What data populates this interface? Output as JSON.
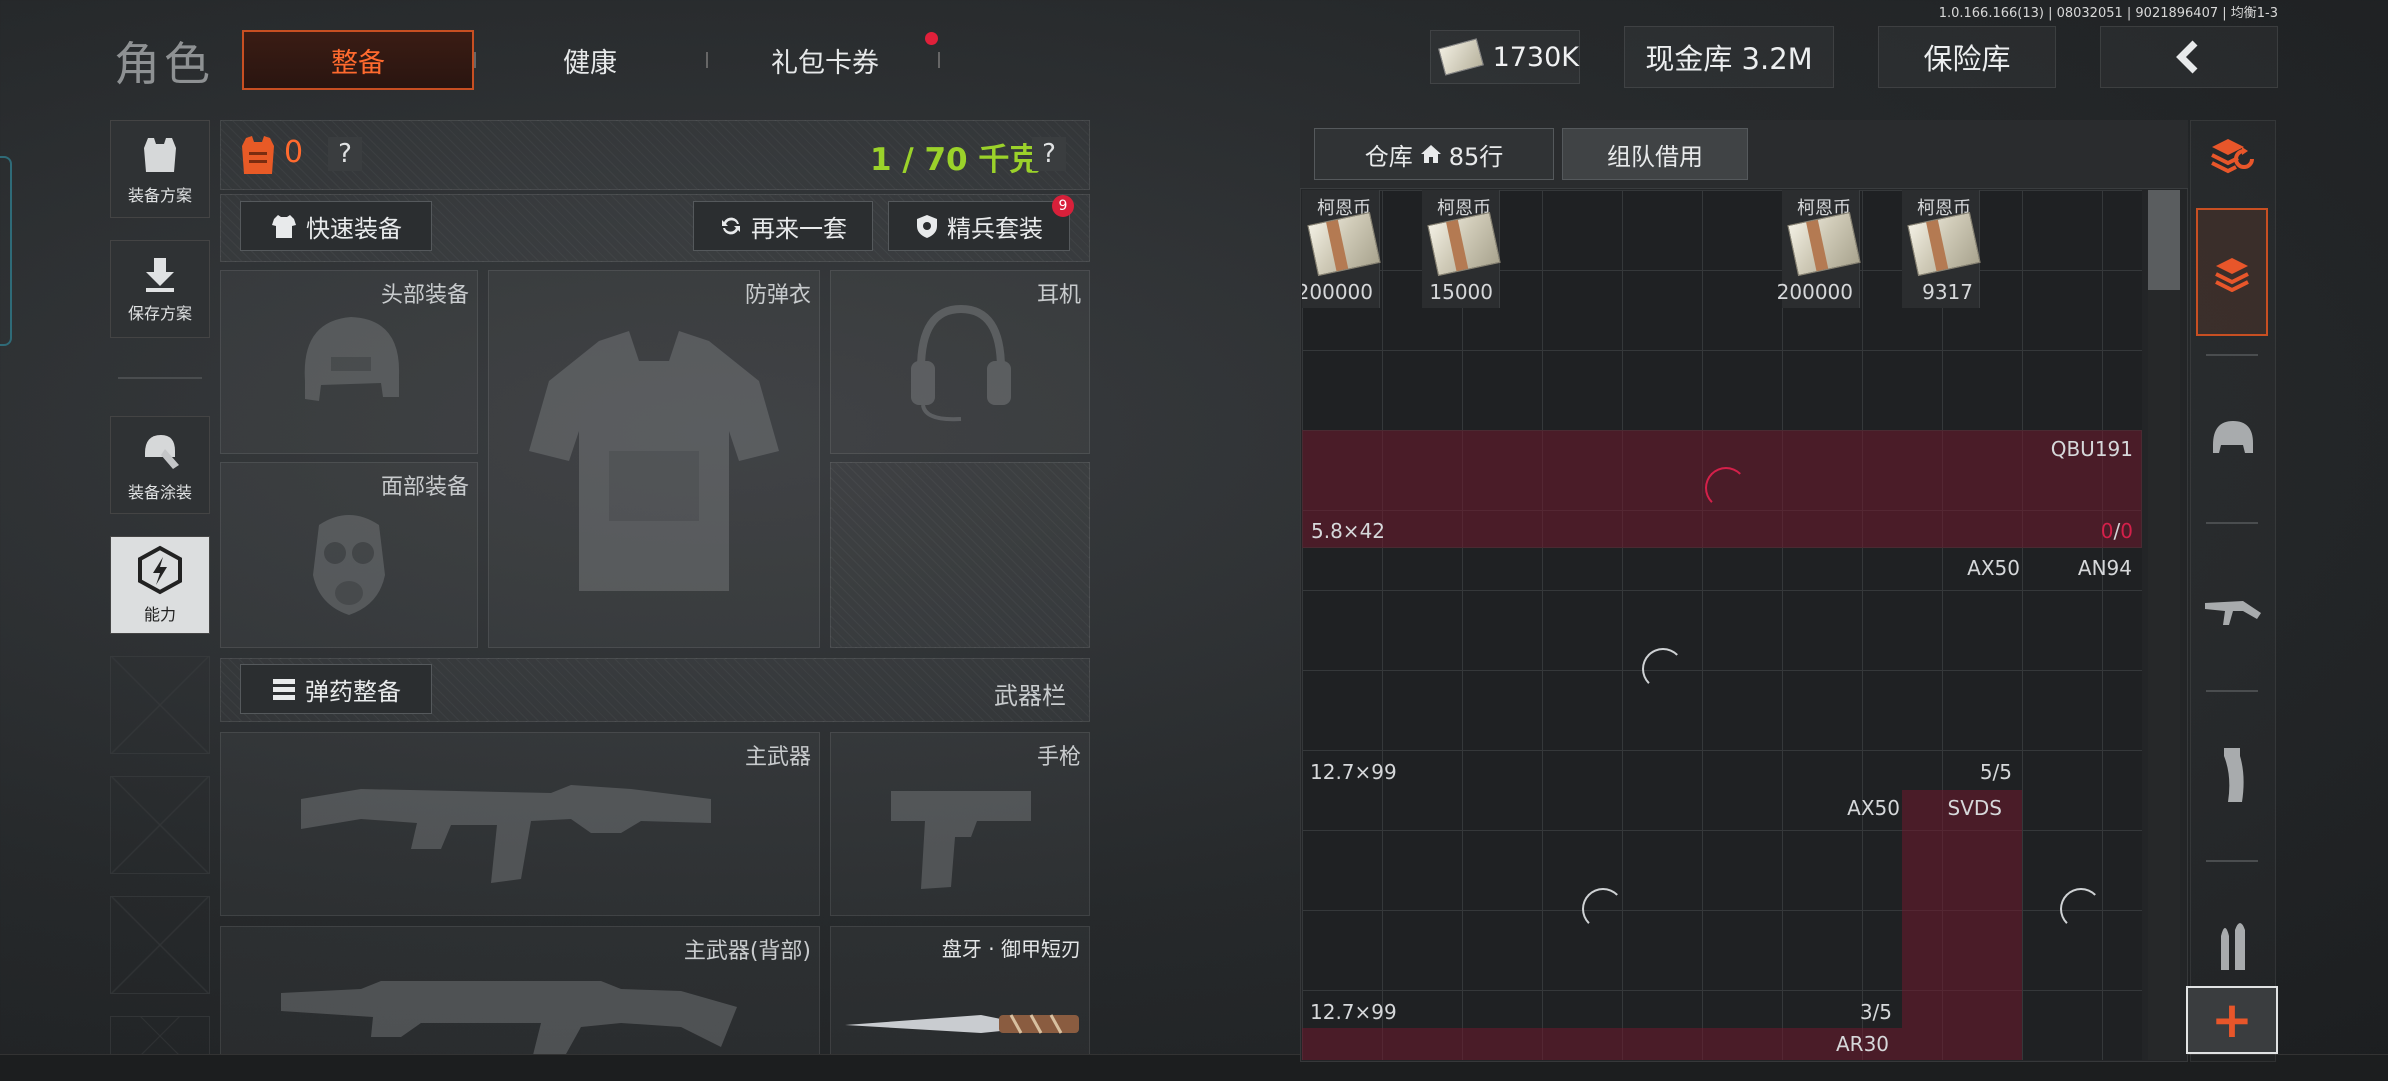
{
  "version": "1.0.166.166(13) | 08032051 | 9021896407 | 均衡1-3",
  "header": {
    "title": "角色",
    "tabs": [
      {
        "label": "整备",
        "active": true
      },
      {
        "label": "健康",
        "active": false
      },
      {
        "label": "礼包卡券",
        "active": false,
        "badge_dot": true
      }
    ],
    "currency": "1730K",
    "cash_vault": "现金库 3.2M",
    "insurance": "保险库",
    "back": "‹"
  },
  "left_sidebar": {
    "items": [
      {
        "label": "装备方案",
        "icon": "vest-icon"
      },
      {
        "label": "保存方案",
        "icon": "download-icon"
      },
      {
        "label": "装备涂装",
        "icon": "paint-helmet-icon"
      },
      {
        "label": "能力",
        "icon": "ability-icon",
        "active": true
      }
    ]
  },
  "loadout": {
    "armor_count": "0",
    "help": "?",
    "weight": "1 / 70 千克",
    "quick_equip": "快速装备",
    "repeat_set": "再来一套",
    "elite_set": "精兵套装",
    "elite_badge": "9",
    "slots": {
      "head": "头部装备",
      "vest": "防弹衣",
      "headset": "耳机",
      "face": "面部装备"
    },
    "ammo_equip": "弹药整备",
    "weapon_bar": "武器栏",
    "primary": "主武器",
    "pistol": "手枪",
    "primary_back": "主武器(背部)",
    "melee": "盘牙 · 御甲短刃"
  },
  "inventory": {
    "warehouse_label": "仓库",
    "warehouse_rows": "85行",
    "team_borrow": "组队借用",
    "money_items": [
      {
        "name": "柯恩币",
        "amount": "200000"
      },
      {
        "name": "柯恩币",
        "amount": "15000"
      },
      {
        "name": "柯恩币",
        "amount": "200000"
      },
      {
        "name": "柯恩币",
        "amount": "9317"
      }
    ],
    "row_qbu": {
      "weapon": "QBU191",
      "caliber": "5.8×42",
      "count_a": "0",
      "count_b": "0"
    },
    "row_2": {
      "weapon_a": "AX50",
      "weapon_b": "AN94",
      "caliber": "12.7×99",
      "count": "5/5"
    },
    "row_3": {
      "weapon_a": "AX50",
      "weapon_b": "SVDS",
      "caliber": "12.7×99",
      "count": "3/5"
    },
    "row_4": {
      "weapon_a": "AR30"
    }
  },
  "right_sidebar": {
    "icons": [
      "stack-refresh-icon",
      "stack-box-icon",
      "helmet-icon",
      "rifle-icon",
      "magazine-icon",
      "ammo-icon",
      "plus-icon"
    ],
    "plus": "+"
  },
  "colors": {
    "accent": "#e8562a",
    "weight_green": "#9bd22a",
    "crimson": "#d4204a"
  }
}
